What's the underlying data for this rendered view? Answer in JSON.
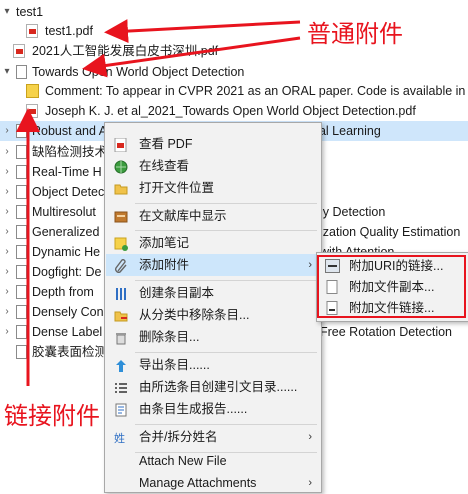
{
  "tree": {
    "rows": [
      {
        "caret": "▾",
        "label": "test1"
      },
      {
        "label": "test1.pdf"
      },
      {
        "label": "2021人工智能发展白皮书深圳.pdf"
      },
      {
        "caret": "▾",
        "label": "Towards Open World Object Detection"
      },
      {
        "label": "Comment: To appear in CVPR 2021 as an ORAL paper. Code is available in"
      },
      {
        "label": "Joseph K. J. et al_2021_Towards Open World Object Detection.pdf"
      },
      {
        "caret": "›",
        "label": "Robust and Accurate Object Detection via Adversarial Learning"
      },
      {
        "caret": "›",
        "label": "缺陷检测技术"
      },
      {
        "caret": "›",
        "label": "Real-Time H"
      },
      {
        "caret": "›",
        "label": "Object Detec"
      },
      {
        "caret": "›",
        "label": "Multiresolut",
        "tail": "ly Detection"
      },
      {
        "caret": "›",
        "label": "Generalized",
        "tail": "ization Quality Estimation"
      },
      {
        "caret": "›",
        "label": "Dynamic He",
        "tail": "with Attention"
      },
      {
        "caret": "›",
        "label": "Dogfight: De"
      },
      {
        "caret": "›",
        "label": "Depth from"
      },
      {
        "caret": "›",
        "label": "Densely Con"
      },
      {
        "caret": "›",
        "label": "Dense Label",
        "tail": "Free Rotation Detection"
      },
      {
        "label": "胶囊表面检测"
      }
    ]
  },
  "menu": {
    "items": [
      {
        "label": "查看 PDF",
        "icon": "pdf-icon"
      },
      {
        "label": "在线查看",
        "icon": "globe-icon"
      },
      {
        "label": "打开文件位置",
        "icon": "folder-icon"
      },
      {
        "label": "在文献库中显示",
        "icon": "library-icon"
      },
      {
        "label": "添加笔记",
        "icon": "note-add-icon"
      },
      {
        "label": "添加附件",
        "icon": "paperclip-icon",
        "submenu": true
      },
      {
        "label": "创建条目副本",
        "icon": "duplicate-icon"
      },
      {
        "label": "从分类中移除条目...",
        "icon": "folder-remove-icon"
      },
      {
        "label": "删除条目...",
        "icon": "trash-icon"
      },
      {
        "label": "导出条目......",
        "icon": "export-icon"
      },
      {
        "label": "由所选条目创建引文目录......",
        "icon": "bibliography-icon"
      },
      {
        "label": "由条目生成报告......",
        "icon": "report-icon"
      },
      {
        "label": "合并/拆分姓名",
        "icon": "names-icon",
        "submenu": true
      },
      {
        "label": "Attach New File",
        "icon": ""
      },
      {
        "label": "Manage Attachments",
        "icon": "",
        "submenu": true
      }
    ]
  },
  "submenu": {
    "items": [
      {
        "label": "附加URI的链接...",
        "icon": "link-icon"
      },
      {
        "label": "附加文件副本...",
        "icon": "file-copy-icon"
      },
      {
        "label": "附加文件链接...",
        "icon": "file-link-icon"
      }
    ]
  },
  "annotations": {
    "normal_attachment": "普通附件",
    "link_attachment": "链接附件"
  },
  "colors": {
    "annotation": "#e8141e",
    "selection": "#cfe6fb",
    "menu_hover": "#cde6fb"
  }
}
